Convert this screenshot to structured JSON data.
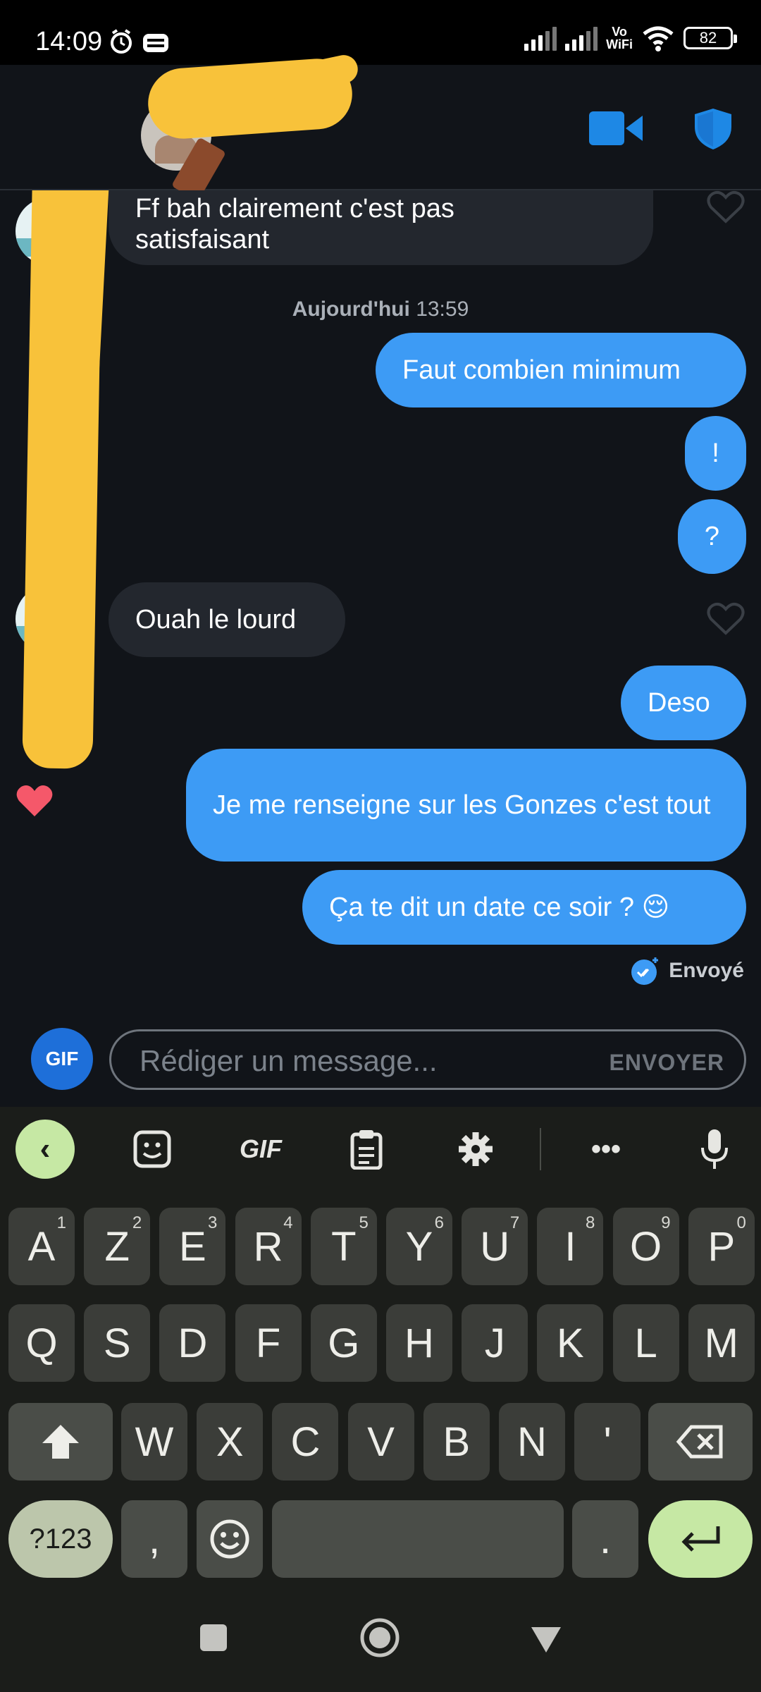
{
  "status_bar": {
    "time": "14:09",
    "vowifi_top": "Vo",
    "vowifi_bottom": "WiFi",
    "battery": "82"
  },
  "header": {
    "video_icon": "video-camera-icon",
    "safety_icon": "shield-icon"
  },
  "messages": {
    "clipped_incoming_line1": "Ff bah clairement c'est pas",
    "clipped_incoming_line2": "satisfaisant",
    "date_day": "Aujourd'hui",
    "date_time": "13:59",
    "out1": "Faut combien minimum",
    "out2": "!",
    "out3": "?",
    "in1": "Ouah le lourd",
    "out4": "Deso",
    "out5": "Je me renseigne sur les Gonzes c'est tout",
    "out6": "Ça te dit un date ce soir ? 😌",
    "status": "Envoyé"
  },
  "composer": {
    "gif_label": "GIF",
    "placeholder": "Rédiger un message...",
    "send_label": "ENVOYER"
  },
  "keyboard": {
    "toolbar_gif": "GIF",
    "row1": [
      {
        "k": "A",
        "n": "1"
      },
      {
        "k": "Z",
        "n": "2"
      },
      {
        "k": "E",
        "n": "3"
      },
      {
        "k": "R",
        "n": "4"
      },
      {
        "k": "T",
        "n": "5"
      },
      {
        "k": "Y",
        "n": "6"
      },
      {
        "k": "U",
        "n": "7"
      },
      {
        "k": "I",
        "n": "8"
      },
      {
        "k": "O",
        "n": "9"
      },
      {
        "k": "P",
        "n": "0"
      }
    ],
    "row2": [
      "Q",
      "S",
      "D",
      "F",
      "G",
      "H",
      "J",
      "K",
      "L",
      "M"
    ],
    "row3": [
      "W",
      "X",
      "C",
      "V",
      "B",
      "N",
      "'"
    ],
    "sym_label": "?123",
    "comma": ",",
    "period": "."
  },
  "colors": {
    "outgoing_bubble": "#3d9bf5",
    "incoming_bubble": "#23272e",
    "background": "#111419",
    "accent_blue": "#1e88e5",
    "like_heart": "#f5586a",
    "keyboard_accent": "#c6e8a4"
  }
}
